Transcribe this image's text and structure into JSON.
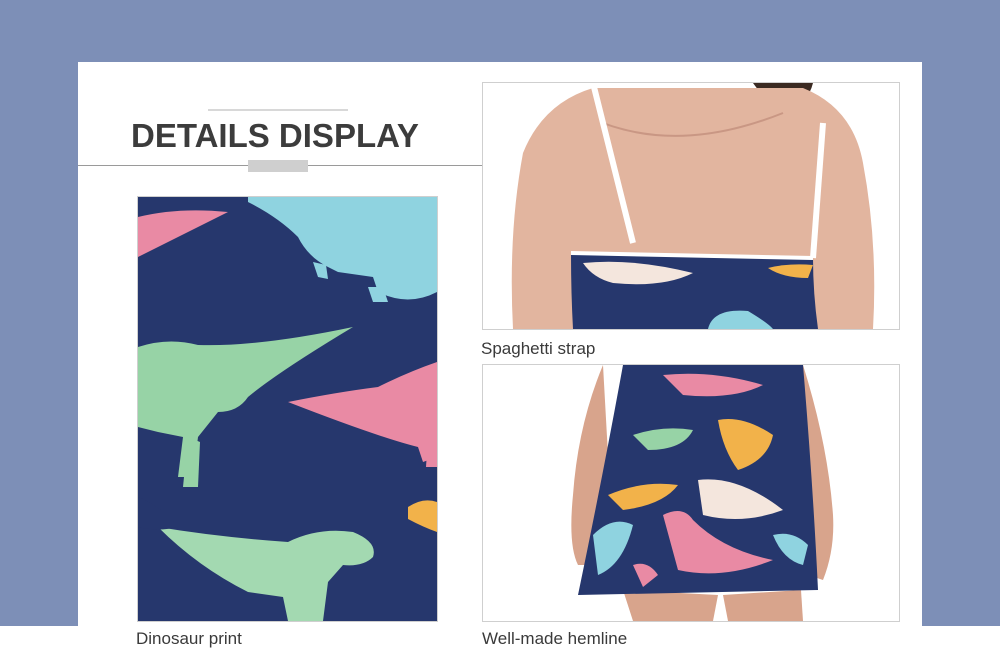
{
  "header": {
    "title": "DETAILS DISPLAY"
  },
  "photos": [
    {
      "caption": "Dinosaur print",
      "icon": "dinosaur-print-closeup"
    },
    {
      "caption": "Spaghetti strap",
      "icon": "back-view-straps"
    },
    {
      "caption": "Well-made hemline",
      "icon": "hemline-view"
    }
  ],
  "colors": {
    "background": "#7d8fb7",
    "panel": "#ffffff",
    "fabric": "#24346b",
    "title": "#3c3c3c"
  }
}
